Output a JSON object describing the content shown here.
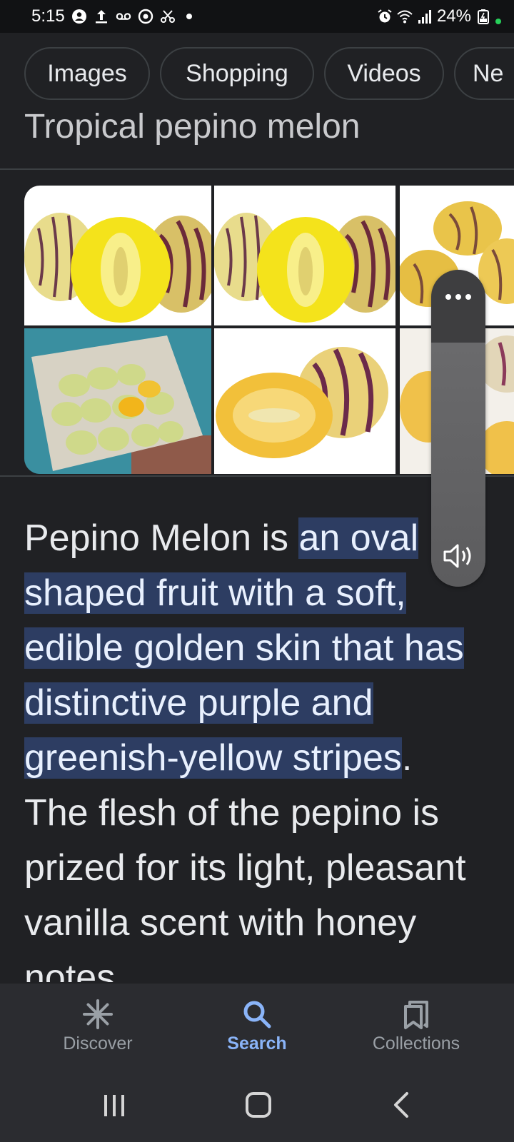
{
  "status": {
    "time": "5:15",
    "battery": "24%"
  },
  "chips": [
    {
      "label": "Images"
    },
    {
      "label": "Shopping"
    },
    {
      "label": "Videos"
    },
    {
      "label": "Ne"
    }
  ],
  "section_title": "Tropical pepino melon",
  "paragraph": {
    "intro": "Pepino Melon is ",
    "highlighted": "an oval shaped fruit with a soft, edible golden skin that has distinctive purple and greenish-yellow stripes",
    "rest": ". The flesh of the pepino is prized for its light, pleasant vanilla scent with honey notes"
  },
  "volume": {
    "level": 0.77
  },
  "bottom_nav": {
    "items": [
      {
        "label": "Discover",
        "icon": "asterisk-icon",
        "active": false
      },
      {
        "label": "Search",
        "icon": "search-icon",
        "active": true
      },
      {
        "label": "Collections",
        "icon": "bookmarks-icon",
        "active": false
      }
    ]
  },
  "colors": {
    "background": "#202124",
    "highlight": "#2d3d62",
    "active": "#8ab4f8",
    "inactive": "#9aa0a6"
  }
}
